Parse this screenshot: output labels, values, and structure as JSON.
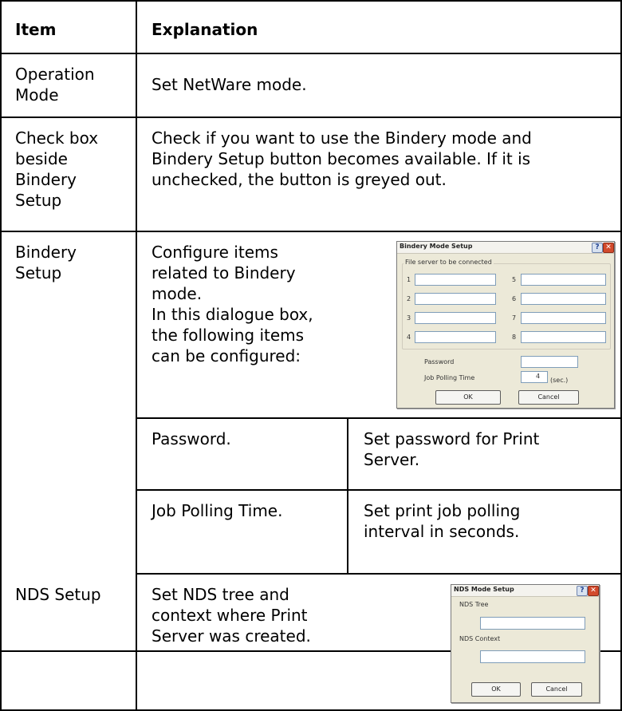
{
  "table": {
    "headers": {
      "item": "Item",
      "explanation": "Explanation"
    },
    "rows": {
      "operation_mode": {
        "item": [
          "Operation",
          "Mode"
        ],
        "explanation": "Set NetWare mode."
      },
      "checkbox": {
        "item": [
          "Check box",
          "beside",
          "Bindery",
          "Setup"
        ],
        "explanation": [
          "Check if you want to use the Bindery mode and",
          "Bindery Setup button becomes available. If it is",
          "unchecked, the button is greyed out."
        ]
      },
      "bindery": {
        "item": [
          "Bindery",
          "Setup"
        ],
        "explanation": [
          "Configure items",
          "related to Bindery",
          "mode.",
          "In this dialogue box,",
          "the following items",
          "can be configured:"
        ],
        "sub_rows": [
          {
            "item": "Password.",
            "explanation": [
              "Set password for Print",
              "Server."
            ]
          },
          {
            "item": "Job Polling Time.",
            "explanation": [
              "Set print job polling",
              "interval in seconds."
            ]
          }
        ]
      },
      "nds": {
        "item": "NDS Setup",
        "explanation": [
          "Set NDS tree and",
          "context where Print",
          "Server was created."
        ]
      }
    }
  },
  "bindery_dialog": {
    "title": "Bindery Mode Setup",
    "group_label": "File server to be connected",
    "server_numbers": [
      "1",
      "2",
      "3",
      "4",
      "5",
      "6",
      "7",
      "8"
    ],
    "password_label": "Password",
    "polling_label": "Job Polling Time",
    "polling_value": "4",
    "polling_unit": "(sec.)",
    "ok_label": "OK",
    "cancel_label": "Cancel"
  },
  "nds_dialog": {
    "title": "NDS Mode Setup",
    "tree_label": "NDS Tree",
    "context_label": "NDS Context",
    "ok_label": "OK",
    "cancel_label": "Cancel"
  },
  "icons": {
    "help": "help-icon",
    "close": "close-icon"
  }
}
